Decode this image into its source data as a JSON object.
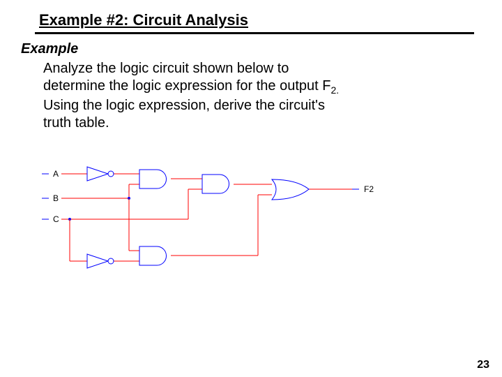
{
  "title": "Example #2: Circuit Analysis",
  "example_label": "Example",
  "body": {
    "l1": "Analyze the logic circuit shown below to",
    "l2_a": "determine the logic expression for the output F",
    "l2_sub": "2.",
    "l3": "Using the logic expression, derive the circuit's",
    "l4": "truth table."
  },
  "circuit": {
    "inputs": {
      "A": "A",
      "B": "B",
      "C": "C"
    },
    "output": "F2",
    "gates": [
      {
        "id": "not1",
        "type": "NOT",
        "in": [
          "A"
        ]
      },
      {
        "id": "not2",
        "type": "NOT",
        "in": [
          "C"
        ]
      },
      {
        "id": "and1",
        "type": "AND",
        "in": [
          "not1",
          "B"
        ]
      },
      {
        "id": "and2",
        "type": "AND",
        "in": [
          "B",
          "not2"
        ]
      },
      {
        "id": "and3",
        "type": "AND",
        "in": [
          "and1",
          "C"
        ]
      },
      {
        "id": "or1",
        "type": "OR",
        "in": [
          "and3",
          "and2"
        ],
        "out": "F2"
      }
    ]
  },
  "page_number": "23"
}
